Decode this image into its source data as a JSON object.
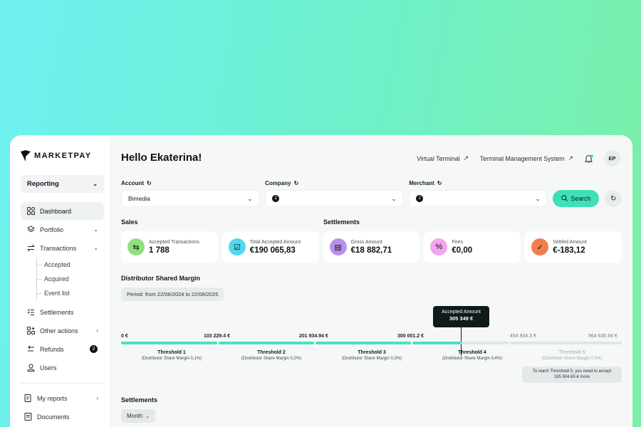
{
  "brand": {
    "name": "MARKETPAY"
  },
  "sidebar": {
    "selector_label": "Reporting",
    "items": [
      {
        "label": "Dashboard",
        "icon": "grid-icon"
      },
      {
        "label": "Portfolio",
        "icon": "layers-icon"
      },
      {
        "label": "Transactions",
        "icon": "arrows-icon"
      },
      {
        "label": "Settlements",
        "icon": "checklist-icon"
      },
      {
        "label": "Other actions",
        "icon": "apps-icon"
      },
      {
        "label": "Refunds",
        "icon": "refund-icon",
        "badge": "2"
      },
      {
        "label": "Users",
        "icon": "user-icon"
      }
    ],
    "transactions_sub": [
      "Accepted",
      "Acquired",
      "Event list"
    ],
    "bottom_items": [
      {
        "label": "My reports",
        "icon": "report-icon"
      },
      {
        "label": "Documents",
        "icon": "document-icon"
      }
    ]
  },
  "header": {
    "greeting": "Hello Ekaterina!",
    "links": [
      "Virtual Terminal",
      "Terminal Management System"
    ],
    "avatar_initials": "EP"
  },
  "filters": {
    "account": {
      "label": "Account",
      "value": "Bimedia"
    },
    "company": {
      "label": "Company",
      "badge": "2"
    },
    "merchant": {
      "label": "Merchant",
      "badge": "2"
    },
    "search_label": "Search"
  },
  "sections": {
    "sales": "Sales",
    "settlements": "Settlements",
    "margin": "Distributor Shared Margin",
    "settlements_bottom": "Settlements"
  },
  "cards": [
    {
      "label": "Accepted Transactions",
      "value": "1 788",
      "color": "#8fe07f",
      "icon": "arrows-icon"
    },
    {
      "label": "Total Accepted Amount",
      "value": "€190 065,83",
      "color": "#52d7f0",
      "icon": "check-doc-icon"
    },
    {
      "label": "Gross Amount",
      "value": "€18 882,71",
      "color": "#b892ef",
      "icon": "receipt-icon"
    },
    {
      "label": "Fees",
      "value": "€0,00",
      "color": "#f2a6ec",
      "icon": "percent-icon"
    },
    {
      "label": "Settled Amount",
      "value": "€-183,12",
      "color": "#f07e4e",
      "icon": "check-circle-icon"
    }
  ],
  "margin": {
    "period": "Period: from 22/06/2024 to 22/06/2025",
    "tooltip_label": "Accepted Amount",
    "tooltip_value": "305 349 €",
    "ticks": [
      "0 €",
      "103 229.4 €",
      "201 934.94 €",
      "300 001.2 €",
      "454 934.3 €",
      "564 635.94 €"
    ],
    "thresholds": [
      {
        "name": "Threshold 1",
        "sub": "(Distributor Share Margin 0,1%)"
      },
      {
        "name": "Threshold 2",
        "sub": "(Distributor Share Margin 0,2%)"
      },
      {
        "name": "Threshold 3",
        "sub": "(Distributor Share Margin 0,3%)"
      },
      {
        "name": "Threshold 4",
        "sub": "(Distributor Share Margin 0,4%)"
      },
      {
        "name": "Threshold 5",
        "sub": "(Distributor Share Margin 0,5%)"
      }
    ],
    "hint_line1": "To reach Threshold 5, you need to accept",
    "hint_line2": "165 504.65 € more"
  },
  "month_label": "Month",
  "colors": {
    "accent": "#3fe0b8",
    "progress": "#47e3c0"
  }
}
